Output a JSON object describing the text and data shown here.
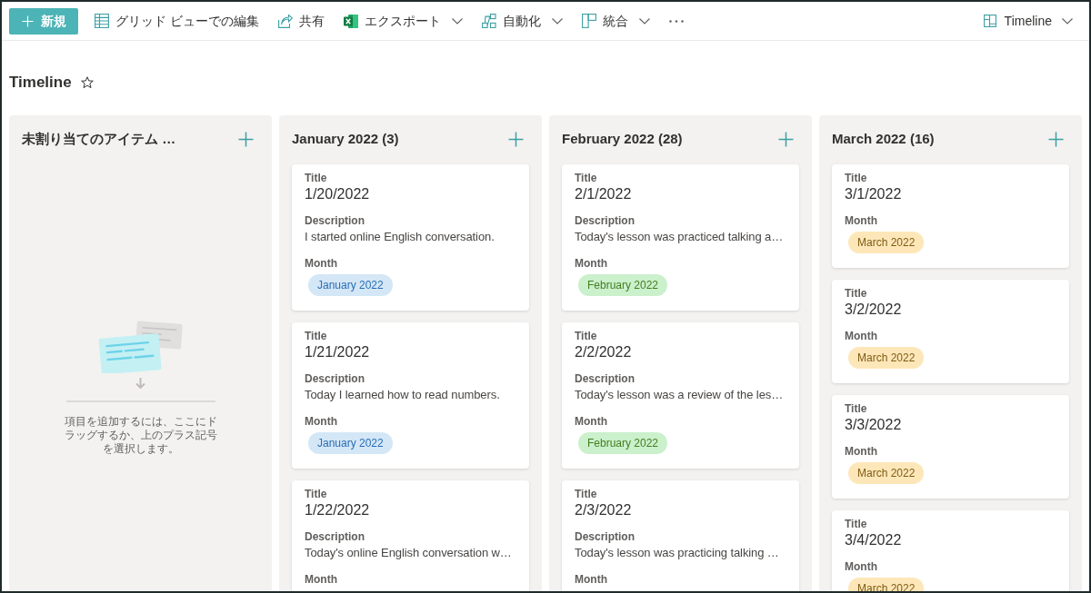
{
  "toolbar": {
    "new_button": {
      "label": "新規"
    },
    "commands": [
      {
        "kind": "edit",
        "label": "グリッド ビューでの編集",
        "has_menu": false
      },
      {
        "kind": "share",
        "label": "共有",
        "has_menu": false
      },
      {
        "kind": "export",
        "label": "エクスポート",
        "has_menu": true
      },
      {
        "kind": "automate",
        "label": "自動化",
        "has_menu": true
      },
      {
        "kind": "integrate",
        "label": "統合",
        "has_menu": true
      }
    ],
    "view_switcher": {
      "label": "Timeline",
      "has_menu": true
    }
  },
  "page": {
    "title": "Timeline",
    "favorite": false
  },
  "board": {
    "columns": [
      {
        "title": "未割り当てのアイテム …",
        "empty_message": "項目を追加するには、ここにドラッグするか、上のプラス記号を選択します。"
      },
      {
        "title": "January 2022 (3)",
        "cards": [
          {
            "fields": [
              {
                "kind": "title",
                "label": "Title",
                "value": "1/20/2022"
              },
              {
                "kind": "text",
                "label": "Description",
                "value": "I started online English conversation."
              },
              {
                "kind": "tag",
                "label": "Month",
                "value": "January 2022",
                "color": "#d4e7f6"
              }
            ]
          },
          {
            "fields": [
              {
                "kind": "title",
                "label": "Title",
                "value": "1/21/2022"
              },
              {
                "kind": "text",
                "label": "Description",
                "value": "Today I learned how to read numbers."
              },
              {
                "kind": "tag",
                "label": "Month",
                "value": "January 2022",
                "color": "#d4e7f6"
              }
            ]
          },
          {
            "fields": [
              {
                "kind": "title",
                "label": "Title",
                "value": "1/22/2022"
              },
              {
                "kind": "text",
                "label": "Description",
                "value": "Today's online English conversation w…"
              },
              {
                "kind": "tag",
                "label": "Month"
              }
            ]
          }
        ]
      },
      {
        "title": "February 2022 (28)",
        "cards": [
          {
            "fields": [
              {
                "kind": "title",
                "label": "Title",
                "value": "2/1/2022"
              },
              {
                "kind": "text",
                "label": "Description",
                "value": "Today's lesson was practiced talking a…"
              },
              {
                "kind": "tag",
                "label": "Month",
                "value": "February 2022",
                "color": "#caf0cc"
              }
            ]
          },
          {
            "fields": [
              {
                "kind": "title",
                "label": "Title",
                "value": "2/2/2022"
              },
              {
                "kind": "text",
                "label": "Description",
                "value": "Today's lesson was a review of the les…"
              },
              {
                "kind": "tag",
                "label": "Month",
                "value": "February 2022",
                "color": "#caf0cc"
              }
            ]
          },
          {
            "fields": [
              {
                "kind": "title",
                "label": "Title",
                "value": "2/3/2022"
              },
              {
                "kind": "text",
                "label": "Description",
                "value": "Today's lesson was practicing talking …"
              },
              {
                "kind": "tag",
                "label": "Month"
              }
            ]
          }
        ]
      },
      {
        "title": "March 2022 (16)",
        "cards": [
          {
            "fields": [
              {
                "kind": "title",
                "label": "Title",
                "value": "3/1/2022"
              },
              {
                "kind": "tag",
                "label": "Month",
                "value": "March 2022",
                "color": "#fde7b9"
              }
            ]
          },
          {
            "fields": [
              {
                "kind": "title",
                "label": "Title",
                "value": "3/2/2022"
              },
              {
                "kind": "tag",
                "label": "Month",
                "value": "March 2022",
                "color": "#fde7b9"
              }
            ]
          },
          {
            "fields": [
              {
                "kind": "title",
                "label": "Title",
                "value": "3/3/2022"
              },
              {
                "kind": "tag",
                "label": "Month",
                "value": "March 2022",
                "color": "#fde7b9"
              }
            ]
          },
          {
            "fields": [
              {
                "kind": "title",
                "label": "Title",
                "value": "3/4/2022"
              },
              {
                "kind": "tag",
                "label": "Month",
                "value": "March 2022",
                "color": "#fde7b9"
              }
            ]
          }
        ]
      }
    ]
  }
}
